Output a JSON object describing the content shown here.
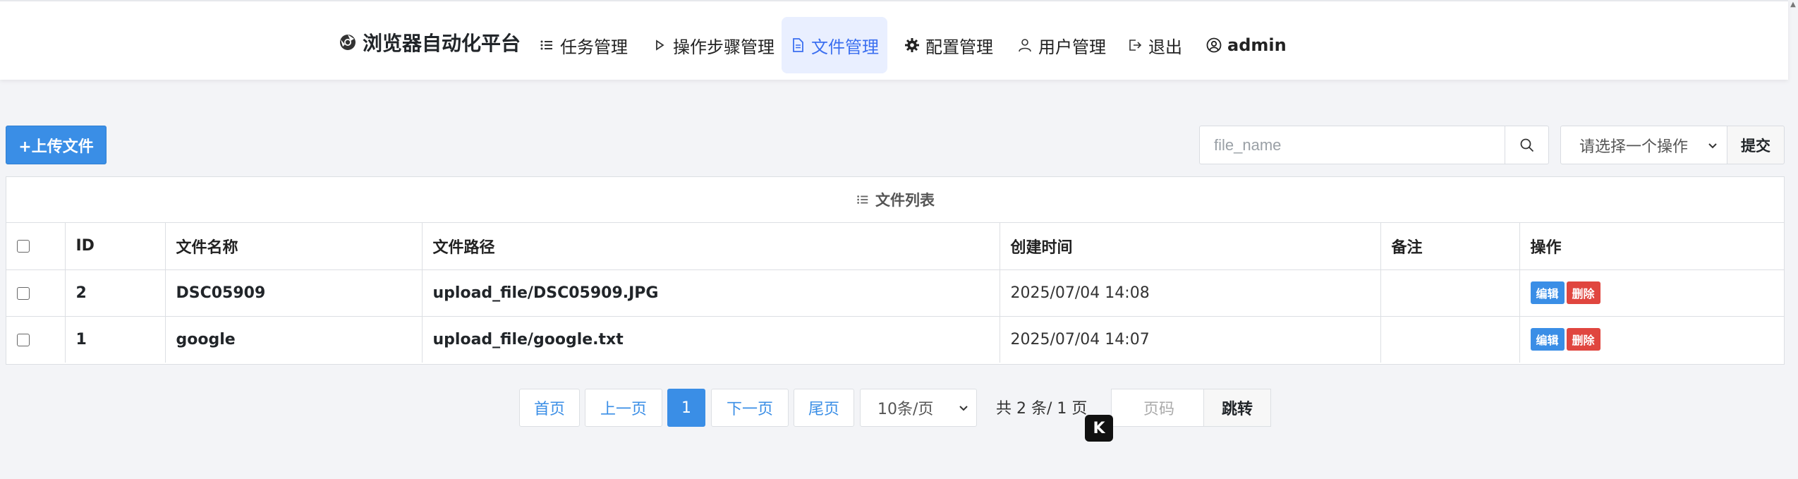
{
  "nav": {
    "brand": "浏览器自动化平台",
    "items": [
      {
        "label": "任务管理",
        "icon": "list-icon"
      },
      {
        "label": "操作步骤管理",
        "icon": "play-icon"
      },
      {
        "label": "文件管理",
        "icon": "file-icon",
        "active": true
      },
      {
        "label": "配置管理",
        "icon": "gear-icon"
      },
      {
        "label": "用户管理",
        "icon": "user-icon"
      },
      {
        "label": "退出",
        "icon": "logout-icon"
      },
      {
        "label": "admin",
        "icon": "user-circle-icon"
      }
    ]
  },
  "toolbar": {
    "upload_label": "+上传文件",
    "search_placeholder": "file_name",
    "operation_select": "请选择一个操作",
    "submit_label": "提交"
  },
  "table": {
    "title": "文件列表",
    "headers": [
      "ID",
      "文件名称",
      "文件路径",
      "创建时间",
      "备注",
      "操作"
    ],
    "rows": [
      {
        "id": "2",
        "name": "DSC05909",
        "path": "upload_file/DSC05909.JPG",
        "created": "2025/07/04 14:08",
        "remark": "",
        "edit": "编辑",
        "delete": "删除"
      },
      {
        "id": "1",
        "name": "google",
        "path": "upload_file/google.txt",
        "created": "2025/07/04 14:07",
        "remark": "",
        "edit": "编辑",
        "delete": "删除"
      }
    ]
  },
  "pagination": {
    "first": "首页",
    "prev": "上一页",
    "current": "1",
    "next": "下一页",
    "last": "尾页",
    "page_size": "10条/页",
    "total": "共 2 条/ 1 页",
    "page_input_placeholder": "页码",
    "jump": "跳转"
  },
  "colors": {
    "accent": "#3a8ee6",
    "danger": "#e0463f",
    "active_nav_bg": "#e9efff",
    "active_nav_text": "#3b6ff0"
  }
}
